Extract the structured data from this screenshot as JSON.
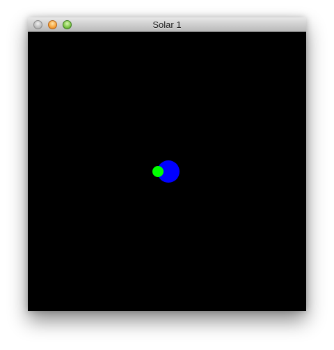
{
  "window": {
    "title": "Solar 1"
  },
  "scene": {
    "background_color": "#000000",
    "sun_color": "#0000ff",
    "planet_color": "#00ff00"
  },
  "icons": {
    "close": "close-button-icon",
    "minimize": "minimize-button-icon",
    "zoom": "zoom-button-icon"
  }
}
